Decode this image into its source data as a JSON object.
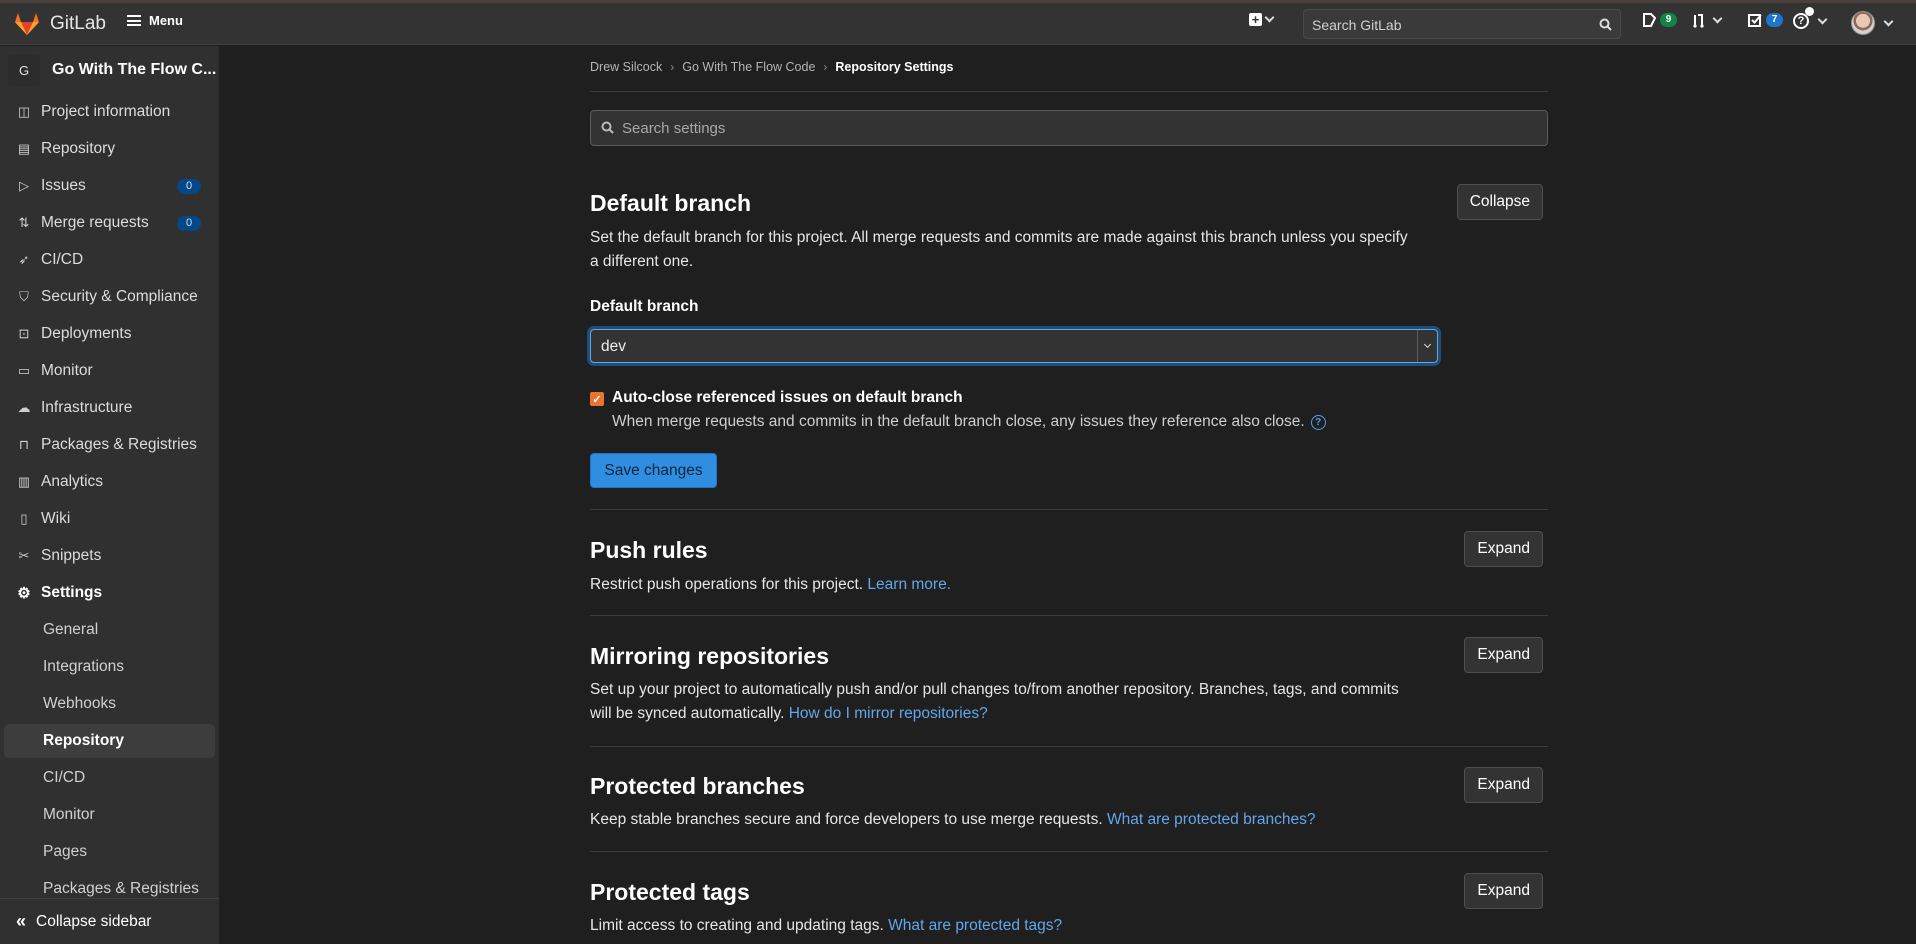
{
  "header": {
    "brand": "GitLab",
    "menu_label": "Menu",
    "search_placeholder": "Search GitLab",
    "issues_count": "9",
    "todos_count": "7",
    "colors": {
      "issues_badge": "#108548",
      "todos_badge": "#1f75cb",
      "logo": "#e24329"
    }
  },
  "sidebar": {
    "project_initial": "G",
    "project_name": "Go With The Flow C...",
    "items": [
      {
        "label": "Project information",
        "icon": "project-icon"
      },
      {
        "label": "Repository",
        "icon": "document-icon"
      },
      {
        "label": "Issues",
        "icon": "issues-icon",
        "count": "0"
      },
      {
        "label": "Merge requests",
        "icon": "merge-request-icon",
        "count": "0"
      },
      {
        "label": "CI/CD",
        "icon": "rocket-icon"
      },
      {
        "label": "Security & Compliance",
        "icon": "shield-icon"
      },
      {
        "label": "Deployments",
        "icon": "deployments-icon"
      },
      {
        "label": "Monitor",
        "icon": "monitor-icon"
      },
      {
        "label": "Infrastructure",
        "icon": "cloud-gear-icon"
      },
      {
        "label": "Packages & Registries",
        "icon": "package-icon"
      },
      {
        "label": "Analytics",
        "icon": "chart-icon"
      },
      {
        "label": "Wiki",
        "icon": "book-icon"
      },
      {
        "label": "Snippets",
        "icon": "snippet-icon"
      },
      {
        "label": "Settings",
        "icon": "gear-icon"
      }
    ],
    "settings_sub": [
      {
        "label": "General"
      },
      {
        "label": "Integrations"
      },
      {
        "label": "Webhooks"
      },
      {
        "label": "Repository",
        "active": true
      },
      {
        "label": "CI/CD"
      },
      {
        "label": "Monitor"
      },
      {
        "label": "Pages"
      },
      {
        "label": "Packages & Registries"
      }
    ],
    "collapse_label": "Collapse sidebar"
  },
  "breadcrumb": [
    "Drew Silcock",
    "Go With The Flow Code",
    "Repository Settings"
  ],
  "search_settings_placeholder": "Search settings",
  "sections": {
    "default_branch": {
      "title": "Default branch",
      "description": "Set the default branch for this project. All merge requests and commits are made against this branch unless you specify a different one.",
      "toggle_label": "Collapse",
      "field_label": "Default branch",
      "selected_value": "dev",
      "checkbox_label": "Auto-close referenced issues on default branch",
      "checkbox_checked": true,
      "checkbox_help": "When merge requests and commits in the default branch close, any issues they reference also close.",
      "save_label": "Save changes"
    },
    "push_rules": {
      "title": "Push rules",
      "description": "Restrict push operations for this project.",
      "link": "Learn more.",
      "toggle_label": "Expand"
    },
    "mirroring": {
      "title": "Mirroring repositories",
      "description": "Set up your project to automatically push and/or pull changes to/from another repository. Branches, tags, and commits will be synced automatically.",
      "link": "How do I mirror repositories?",
      "toggle_label": "Expand"
    },
    "protected_branches": {
      "title": "Protected branches",
      "description": "Keep stable branches secure and force developers to use merge requests.",
      "link": "What are protected branches?",
      "toggle_label": "Expand"
    },
    "protected_tags": {
      "title": "Protected tags",
      "description": "Limit access to creating and updating tags.",
      "link": "What are protected tags?",
      "toggle_label": "Expand"
    }
  }
}
